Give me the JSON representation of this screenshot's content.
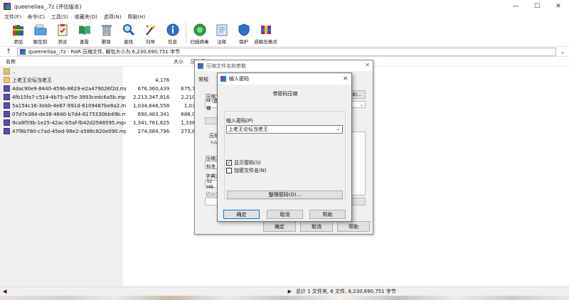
{
  "window": {
    "title": "queeneliaa_.7z (评估版本)",
    "controls": {
      "minimize": "—",
      "maximize": "☐",
      "close": "✕"
    }
  },
  "menu": [
    "文件(F)",
    "命令(C)",
    "工具(S)",
    "收藏夹(O)",
    "选项(N)",
    "帮助(H)"
  ],
  "toolbar": [
    {
      "label": "添加",
      "icon": "add-books-icon"
    },
    {
      "label": "解压到",
      "icon": "extract-folder-icon"
    },
    {
      "label": "测试",
      "icon": "test-clipboard-icon"
    },
    {
      "label": "查看",
      "icon": "view-book-icon"
    },
    {
      "label": "删除",
      "icon": "trash-icon"
    },
    {
      "label": "查找",
      "icon": "find-magnifier-icon"
    },
    {
      "label": "向导",
      "icon": "wizard-wand-icon"
    },
    {
      "label": "信息",
      "icon": "info-icon"
    },
    {
      "label": "扫描病毒",
      "icon": "virus-scan-icon"
    },
    {
      "label": "注释",
      "icon": "comment-icon"
    },
    {
      "label": "保护",
      "icon": "shield-icon"
    },
    {
      "label": "自解压格式",
      "icon": "sfx-icon"
    }
  ],
  "addressbar": {
    "up": "↑",
    "path": "queeneliaa_.7z - RAR 压缩文件, 解包大小为 6,230,690,751 字节",
    "dropdown": "⌄"
  },
  "filelist": {
    "headers": {
      "name": "名称",
      "size": "大小",
      "packed": "压缩后大"
    },
    "rows": [
      {
        "name": "..",
        "size": "",
        "packed": "",
        "type": "up"
      },
      {
        "name": "上老王论坛当老王",
        "size": "4,176",
        "packed": "2,6",
        "type": "folder"
      },
      {
        "name": "4dac90e9-8440-459b-8629-e2a479026f2d.mp...",
        "size": "676,360,439",
        "packed": "675,793,0",
        "type": "video"
      },
      {
        "name": "4fb15fa7-c514-4b75-a75e-3993cedc6a5b.mp...",
        "size": "2,213,347,816",
        "packed": "2,210,443",
        "type": "video"
      },
      {
        "name": "5a154c16-3ebb-4e87-991d-6109487be8a2.m...",
        "size": "1,034,648,558",
        "packed": "1,031,99",
        "type": "video"
      },
      {
        "name": "07d7e384-de38-4640-b7d4-8175330bb49b.m...",
        "size": "690,483,341",
        "packed": "688,043,6",
        "type": "video"
      },
      {
        "name": "9ca8f59b-1e25-42ac-b5af-fb42d2588595.mp4 *",
        "size": "1,341,761,625",
        "packed": "1,338,611",
        "type": "video"
      },
      {
        "name": "47f8b780-c7ad-45ed-98e2-a586c820e090.mp...",
        "size": "274,084,796",
        "packed": "273,843,8",
        "type": "video"
      }
    ]
  },
  "statusbar": {
    "scroll_left": "◀",
    "scroll_right": "▶",
    "text": "总计 1 文件夹, 6 文件, 6,230,690,751 字节"
  },
  "bg_dialog": {
    "title": "压缩文件名和参数",
    "close": "✕",
    "tab": "常规",
    "label_compress_file": "压缩文",
    "path_partial": "M:\\直播",
    "browse": "(B)...",
    "label_compress_format": "压缩",
    "rar_partial": "RA",
    "label_method": "压缩方",
    "method_value": "标准",
    "label_dict": "字典大",
    "dict_value": "32 MB",
    "label_split": "切分为",
    "ok": "确定",
    "cancel": "取消",
    "help": "帮助"
  },
  "pw_dialog": {
    "title": "输入密码",
    "close": "✕",
    "heading": "带密码压缩",
    "password_label": "输入密码(P)",
    "password_value": "上老王论坛当老王",
    "password_caret": "⌄",
    "show_password": {
      "label": "显示密码(S)",
      "checked": true,
      "mark": "✓"
    },
    "encrypt_names": {
      "label": "加密文件名(N)",
      "checked": false,
      "mark": ""
    },
    "manage_button": "整理密码(O)...",
    "ok": "确定",
    "cancel": "取消",
    "help": "帮助"
  }
}
